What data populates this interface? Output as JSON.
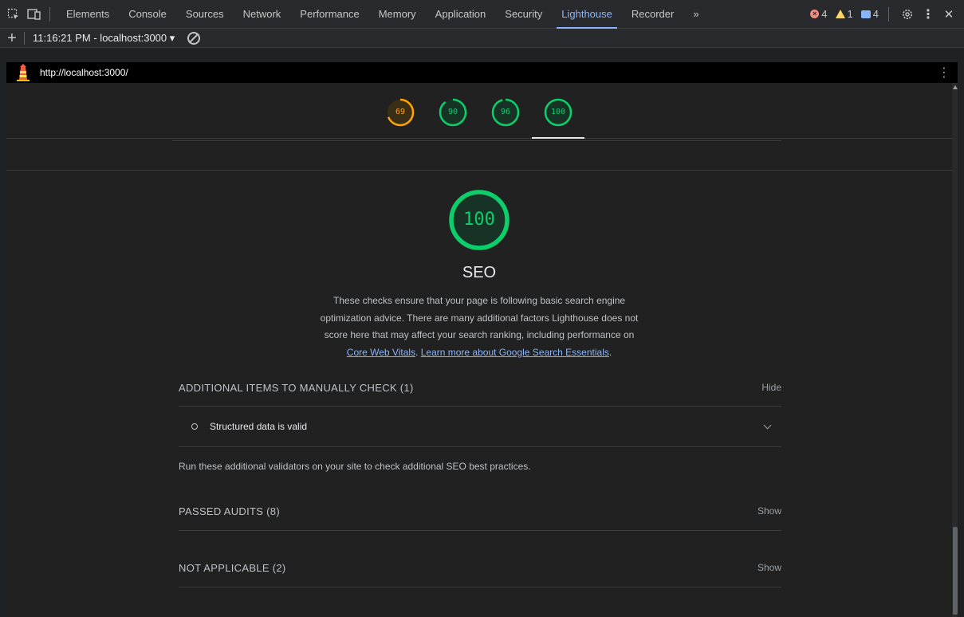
{
  "devtools": {
    "tabs": [
      {
        "label": "Elements"
      },
      {
        "label": "Console"
      },
      {
        "label": "Sources"
      },
      {
        "label": "Network"
      },
      {
        "label": "Performance"
      },
      {
        "label": "Memory"
      },
      {
        "label": "Application"
      },
      {
        "label": "Security"
      },
      {
        "label": "Lighthouse",
        "active": true
      },
      {
        "label": "Recorder"
      }
    ],
    "more_tabs": "»",
    "counters": {
      "errors": "4",
      "warnings": "1",
      "messages": "4"
    },
    "close": "✕"
  },
  "lighthouse_toolbar": {
    "report_label": "11:16:21 PM - localhost:3000 ▾"
  },
  "url_bar": {
    "url": "http://localhost:3000/"
  },
  "scores": {
    "gauges": [
      {
        "value": "69",
        "color": "#ffa400",
        "fraction": 0.69
      },
      {
        "value": "90",
        "color": "#0cce6b",
        "fraction": 0.9
      },
      {
        "value": "96",
        "color": "#0cce6b",
        "fraction": 0.96
      },
      {
        "value": "100",
        "color": "#0cce6b",
        "fraction": 1.0,
        "active": true
      }
    ]
  },
  "category": {
    "score": "100",
    "score_fraction": 1.0,
    "color": "#0cce6b",
    "title": "SEO",
    "description_lines": [
      "These checks ensure that your page is following basic search engine",
      "optimization advice. There are many additional factors Lighthouse does not",
      "score here that may affect your search ranking, including performance on"
    ],
    "link_core": "Core Web Vitals",
    "link_sep": ". ",
    "link_learn": "Learn more about Google Search Essentials",
    "link_end": "."
  },
  "groups": {
    "manual": {
      "title": "ADDITIONAL ITEMS TO MANUALLY CHECK (1)",
      "toggle": "Hide"
    },
    "manual_audit": {
      "title": "Structured data is valid"
    },
    "manual_note": "Run these additional validators on your site to check additional SEO best practices.",
    "passed": {
      "title": "PASSED AUDITS (8)",
      "toggle": "Show"
    },
    "not_applicable": {
      "title": "NOT APPLICABLE (2)",
      "toggle": "Show"
    }
  }
}
